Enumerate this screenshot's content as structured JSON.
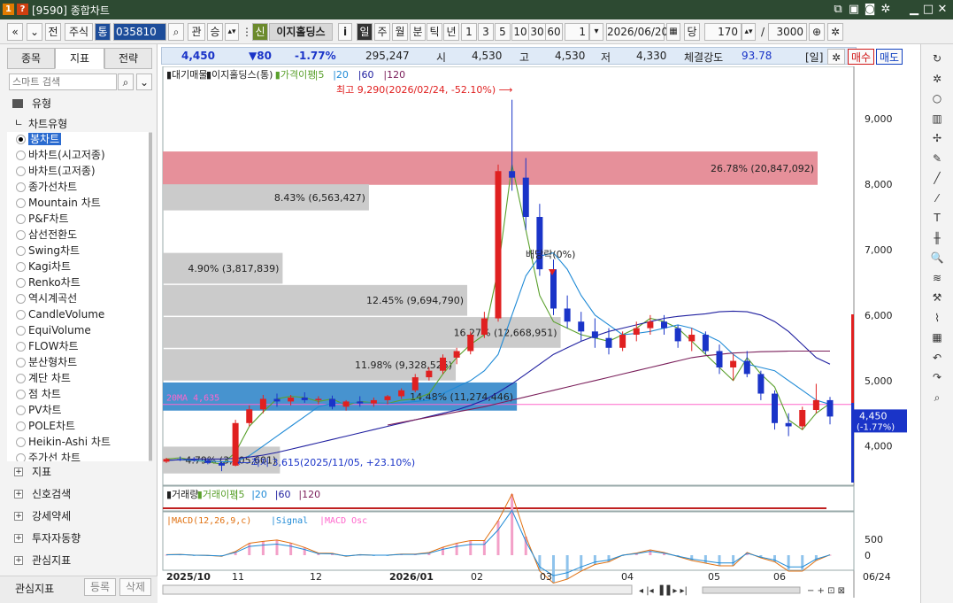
{
  "window": {
    "badge1": "1",
    "badge2": "?",
    "title": "[9590] 종합차트"
  },
  "toolbar": {
    "mode_label": "전",
    "market_label": "주식",
    "tong_label": "통",
    "code": "035810",
    "gwan": "관",
    "seung": "승",
    "sin": "신",
    "stock_name": "이지홀딩스",
    "info": "i",
    "periods": [
      "일",
      "주",
      "월",
      "분",
      "틱",
      "년"
    ],
    "intervals": [
      "1",
      "3",
      "5",
      "10",
      "30",
      "60"
    ],
    "interval_value": "1",
    "date": "2026/06/20",
    "dang": "당",
    "count": "170",
    "slash": "/",
    "total": "3000"
  },
  "left_panel": {
    "tabs": [
      "종목",
      "지표",
      "전략"
    ],
    "search_placeholder": "스마트 검색",
    "group_label": "유형",
    "tree_label": "차트유형",
    "chart_types": [
      "봉차트",
      "바차트(시고저종)",
      "바차트(고저종)",
      "종가선차트",
      "Mountain 차트",
      "P&F차트",
      "삼선전환도",
      "Swing차트",
      "Kagi차트",
      "Renko차트",
      "역시계곡선",
      "CandleVolume",
      "EquiVolume",
      "FLOW차트",
      "분산형차트",
      "계단 차트",
      "점 차트",
      "PV차트",
      "POLE차트",
      "Heikin-Ashi 차트",
      "주가선 차트"
    ],
    "sections": [
      "지표",
      "신호검색",
      "강세약세",
      "투자자동향",
      "관심지표"
    ],
    "footer": {
      "label": "관심지표",
      "register": "등록",
      "delete": "삭제"
    }
  },
  "infobar": {
    "price": "4,450",
    "change": "▼80",
    "change_pct": "-1.77%",
    "volume": "295,247",
    "open_label": "시",
    "open": "4,530",
    "high_label": "고",
    "high": "4,530",
    "low_label": "저",
    "low": "4,330",
    "strength_label": "체결강도",
    "strength": "93.78",
    "period_tag": "[일]",
    "buy": "매수",
    "sell": "매도"
  },
  "chart_data": [
    {
      "type": "candlestick",
      "title": "이지홀딩스(통)",
      "legend": [
        "대기매물",
        "이지홀딩스(통)",
        "가격이평",
        "5",
        "20",
        "60",
        "120"
      ],
      "x_tick_labels": [
        "2025/10",
        "11",
        "12",
        "2026/01",
        "02",
        "03",
        "04",
        "05",
        "06"
      ],
      "y_ticks": [
        4000,
        5000,
        6000,
        7000,
        8000,
        9000
      ],
      "y_tick_labels": [
        "4,000",
        "5,000",
        "6,000",
        "7,000",
        "8,000",
        "9,000"
      ],
      "ylim": [
        3400,
        9800
      ],
      "last_price_label": "4,450",
      "last_change_label": "(-1.77%)",
      "max_annotation": "최고 9,290(2026/02/24, -52.10%)",
      "min_annotation": "최저 3,615(2025/11/05, +23.10%)",
      "dividend_annotation": "배당락(0%)",
      "ma20_line_label": "20MA 4,635",
      "ma20_value": 4635,
      "volume_profile": [
        {
          "label": "26.78% (20,847,092)",
          "low": 7990,
          "high": 8500,
          "pct": 26.78
        },
        {
          "label": "8.43% (6,563,427)",
          "low": 7600,
          "high": 8000,
          "pct": 8.43
        },
        {
          "label": "4.90% (3,817,839)",
          "low": 6480,
          "high": 6950,
          "pct": 4.9
        },
        {
          "label": "12.45% (9,694,790)",
          "low": 5990,
          "high": 6460,
          "pct": 12.45
        },
        {
          "label": "16.27% (12,668,951)",
          "low": 5500,
          "high": 5970,
          "pct": 16.27
        },
        {
          "label": "11.98% (9,328,525)",
          "low": 5000,
          "high": 5480,
          "pct": 11.98
        },
        {
          "label": "14.48% (11,274,446)",
          "low": 4540,
          "high": 4970,
          "pct": 14.48
        },
        {
          "label": "4.79% (3,605,601)",
          "low": 3580,
          "high": 3990,
          "pct": 4.79
        }
      ],
      "series": [
        {
          "name": "5",
          "color": "#5aa02c",
          "values": [
            3800,
            3820,
            3780,
            3760,
            3720,
            3900,
            4300,
            4520,
            4720,
            4760,
            4740,
            4680,
            4720,
            4620,
            4680,
            4660,
            4650,
            4700,
            4720,
            4800,
            5100,
            5350,
            5550,
            5700,
            6700,
            8300,
            7300,
            6300,
            5900,
            5800,
            5700,
            5650,
            5600,
            5700,
            5800,
            5950,
            5900,
            5800,
            5600,
            5400,
            5200,
            5000,
            5350,
            5100,
            4900,
            4400,
            4250,
            4500,
            4650
          ]
        },
        {
          "name": "20",
          "color": "#1f8ad6",
          "values": [
            3780,
            3790,
            3780,
            3770,
            3760,
            3760,
            3850,
            4000,
            4150,
            4300,
            4450,
            4600,
            4650,
            4660,
            4660,
            4660,
            4650,
            4660,
            4680,
            4700,
            4800,
            4900,
            5000,
            5150,
            5400,
            6000,
            6600,
            6900,
            6950,
            6700,
            6300,
            6000,
            5850,
            5700,
            5720,
            5750,
            5800,
            5850,
            5800,
            5700,
            5600,
            5400,
            5250,
            5200,
            5150,
            5000,
            4850,
            4700,
            4635
          ]
        },
        {
          "name": "60",
          "color": "#2020a0",
          "values": [
            3780,
            3790,
            3800,
            3800,
            3800,
            3810,
            3830,
            3860,
            3900,
            3950,
            4000,
            4050,
            4100,
            4150,
            4200,
            4250,
            4300,
            4350,
            4400,
            4450,
            4500,
            4550,
            4620,
            4700,
            4820,
            4950,
            5100,
            5250,
            5400,
            5500,
            5600,
            5680,
            5750,
            5800,
            5850,
            5900,
            5950,
            5980,
            6000,
            6020,
            6050,
            6060,
            6050,
            6000,
            5900,
            5750,
            5550,
            5350,
            5250
          ]
        },
        {
          "name": "120",
          "color": "#7a1e5a",
          "values": [
            null,
            null,
            null,
            null,
            null,
            null,
            null,
            null,
            null,
            null,
            null,
            null,
            null,
            null,
            null,
            null,
            4320,
            4360,
            4400,
            4440,
            4480,
            4520,
            4560,
            4600,
            4650,
            4700,
            4750,
            4800,
            4850,
            4900,
            4950,
            5000,
            5050,
            5100,
            5150,
            5200,
            5250,
            5300,
            5350,
            5380,
            5400,
            5420,
            5430,
            5440,
            5445,
            5450,
            5450,
            5450,
            5450
          ]
        }
      ],
      "candles": [
        [
          3760,
          3820,
          3740,
          3800
        ],
        [
          3800,
          3840,
          3770,
          3790
        ],
        [
          3790,
          3830,
          3760,
          3780
        ],
        [
          3780,
          3810,
          3720,
          3740
        ],
        [
          3740,
          3760,
          3615,
          3700
        ],
        [
          3700,
          4400,
          3690,
          4350
        ],
        [
          4350,
          4620,
          4300,
          4560
        ],
        [
          4560,
          4780,
          4500,
          4720
        ],
        [
          4720,
          4800,
          4600,
          4680
        ],
        [
          4680,
          4780,
          4620,
          4740
        ],
        [
          4740,
          4820,
          4660,
          4700
        ],
        [
          4700,
          4760,
          4640,
          4720
        ],
        [
          4720,
          4770,
          4560,
          4600
        ],
        [
          4600,
          4700,
          4540,
          4680
        ],
        [
          4680,
          4760,
          4600,
          4650
        ],
        [
          4650,
          4740,
          4600,
          4700
        ],
        [
          4700,
          4780,
          4640,
          4760
        ],
        [
          4760,
          4880,
          4720,
          4850
        ],
        [
          4850,
          5100,
          4820,
          5050
        ],
        [
          5050,
          5200,
          5000,
          5150
        ],
        [
          5150,
          5400,
          5100,
          5350
        ],
        [
          5350,
          5500,
          5250,
          5450
        ],
        [
          5450,
          5750,
          5400,
          5700
        ],
        [
          5700,
          6050,
          5650,
          5950
        ],
        [
          5950,
          8300,
          5900,
          8200
        ],
        [
          8200,
          9290,
          7900,
          8100
        ],
        [
          8100,
          8400,
          7300,
          7500
        ],
        [
          7500,
          7700,
          6600,
          6700
        ],
        [
          6700,
          6850,
          6000,
          6100
        ],
        [
          6100,
          6300,
          5800,
          5900
        ],
        [
          5900,
          6050,
          5600,
          5750
        ],
        [
          5750,
          5950,
          5500,
          5650
        ],
        [
          5650,
          5800,
          5400,
          5500
        ],
        [
          5500,
          5750,
          5450,
          5700
        ],
        [
          5700,
          5900,
          5600,
          5800
        ],
        [
          5800,
          6000,
          5700,
          5900
        ],
        [
          5900,
          6000,
          5700,
          5800
        ],
        [
          5800,
          5850,
          5500,
          5600
        ],
        [
          5600,
          5800,
          5450,
          5700
        ],
        [
          5700,
          5750,
          5400,
          5450
        ],
        [
          5450,
          5550,
          5100,
          5200
        ],
        [
          5200,
          5400,
          5000,
          5300
        ],
        [
          5300,
          5450,
          5050,
          5100
        ],
        [
          5100,
          5150,
          4700,
          4800
        ],
        [
          4800,
          4850,
          4250,
          4350
        ],
        [
          4350,
          4500,
          4150,
          4300
        ],
        [
          4300,
          4600,
          4250,
          4550
        ],
        [
          4550,
          4950,
          4500,
          4700
        ],
        [
          4700,
          4750,
          4330,
          4450
        ]
      ]
    },
    {
      "type": "bar",
      "title": "거래량",
      "legend": [
        "거래량",
        "거래이평",
        "5",
        "20",
        "60",
        "120"
      ]
    },
    {
      "type": "line",
      "title": "MACD(12,26,9,c)",
      "legend": [
        "MACD(12,26,9,c)",
        "Signal",
        "MACD Osc"
      ],
      "y_ticks": [
        500,
        0
      ],
      "y_tick_labels": [
        "500",
        "0"
      ]
    }
  ],
  "colors": {
    "up": "#e02020",
    "down": "#1a34c8",
    "title_bar": "#2d4a32",
    "buy": "#d01818",
    "sell": "#1040c0"
  },
  "bottom_date": "06/24",
  "right_icons": [
    "refresh-icon",
    "settings-icon",
    "circle-icon",
    "chart-add-icon",
    "crosshair-icon",
    "pencil-icon",
    "trendline-icon",
    "auto-line-icon",
    "text-icon",
    "candle-add-icon",
    "zoom-box-icon",
    "fibonacci-icon",
    "tool-x-icon",
    "parallel-icon",
    "grid-icon",
    "undo-icon",
    "redo-icon",
    "search-icon"
  ]
}
